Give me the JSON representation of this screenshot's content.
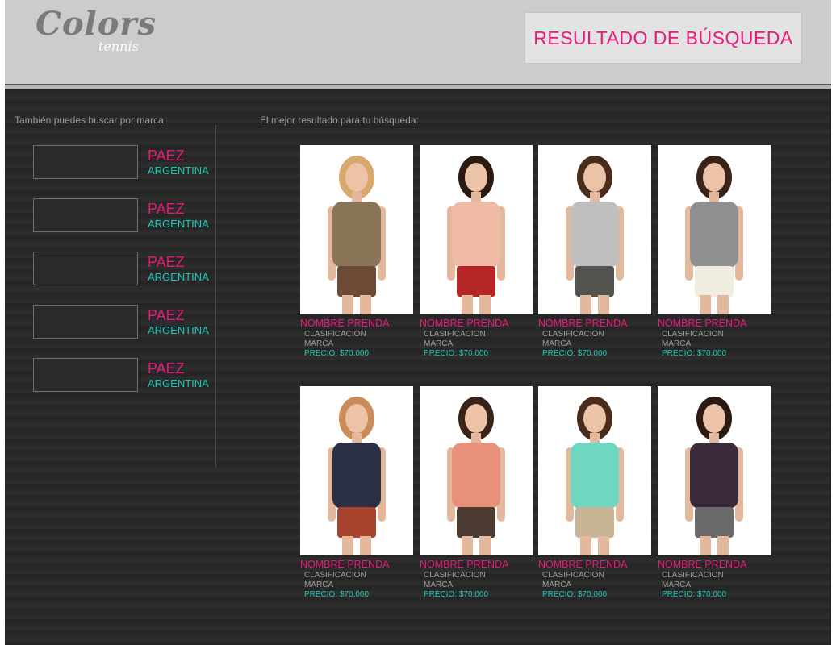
{
  "header": {
    "logo_main": "Colors",
    "logo_sub": "tennis",
    "title": "RESULTADO DE BÚSQUEDA"
  },
  "sidebar": {
    "title": "También puedes buscar por marca",
    "brands": [
      {
        "name": "PAEZ",
        "country": "ARGENTINA"
      },
      {
        "name": "PAEZ",
        "country": "ARGENTINA"
      },
      {
        "name": "PAEZ",
        "country": "ARGENTINA"
      },
      {
        "name": "PAEZ",
        "country": "ARGENTINA"
      },
      {
        "name": "PAEZ",
        "country": "ARGENTINA"
      }
    ]
  },
  "results": {
    "title": "El mejor resultado para tu búsqueda:",
    "products": [
      {
        "name": "NOMBRE PRENDA",
        "classification": "CLASIFICACION",
        "brand": "MARCA",
        "price": "PRECIO: $70.000",
        "top_color": "#8a7558",
        "bottom_color": "#6b4a36",
        "hair_color": "#d9a86c"
      },
      {
        "name": "NOMBRE PRENDA",
        "classification": "CLASIFICACION",
        "brand": "MARCA",
        "price": "PRECIO: $70.000",
        "top_color": "#f0bba4",
        "bottom_color": "#b52626",
        "hair_color": "#2b1a12"
      },
      {
        "name": "NOMBRE PRENDA",
        "classification": "CLASIFICACION",
        "brand": "MARCA",
        "price": "PRECIO: $70.000",
        "top_color": "#bfbfbf",
        "bottom_color": "#55534f",
        "hair_color": "#4a2c1c"
      },
      {
        "name": "NOMBRE PRENDA",
        "classification": "CLASIFICACION",
        "brand": "MARCA",
        "price": "PRECIO: $70.000",
        "top_color": "#8f8f8f",
        "bottom_color": "#f1ece0",
        "hair_color": "#3a241a"
      },
      {
        "name": "NOMBRE PRENDA",
        "classification": "CLASIFICACION",
        "brand": "MARCA",
        "price": "PRECIO: $70.000",
        "top_color": "#2c3044",
        "bottom_color": "#a8442e",
        "hair_color": "#c98c5a"
      },
      {
        "name": "NOMBRE PRENDA",
        "classification": "CLASIFICACION",
        "brand": "MARCA",
        "price": "PRECIO: $70.000",
        "top_color": "#e8907a",
        "bottom_color": "#4a3a30",
        "hair_color": "#3a241a"
      },
      {
        "name": "NOMBRE PRENDA",
        "classification": "CLASIFICACION",
        "brand": "MARCA",
        "price": "PRECIO: $70.000",
        "top_color": "#6fd6c0",
        "bottom_color": "#c9b596",
        "hair_color": "#4a2c1c"
      },
      {
        "name": "NOMBRE PRENDA",
        "classification": "CLASIFICACION",
        "brand": "MARCA",
        "price": "PRECIO: $70.000",
        "top_color": "#3a2a3a",
        "bottom_color": "#6a6a6a",
        "hair_color": "#2b1a12"
      }
    ]
  }
}
